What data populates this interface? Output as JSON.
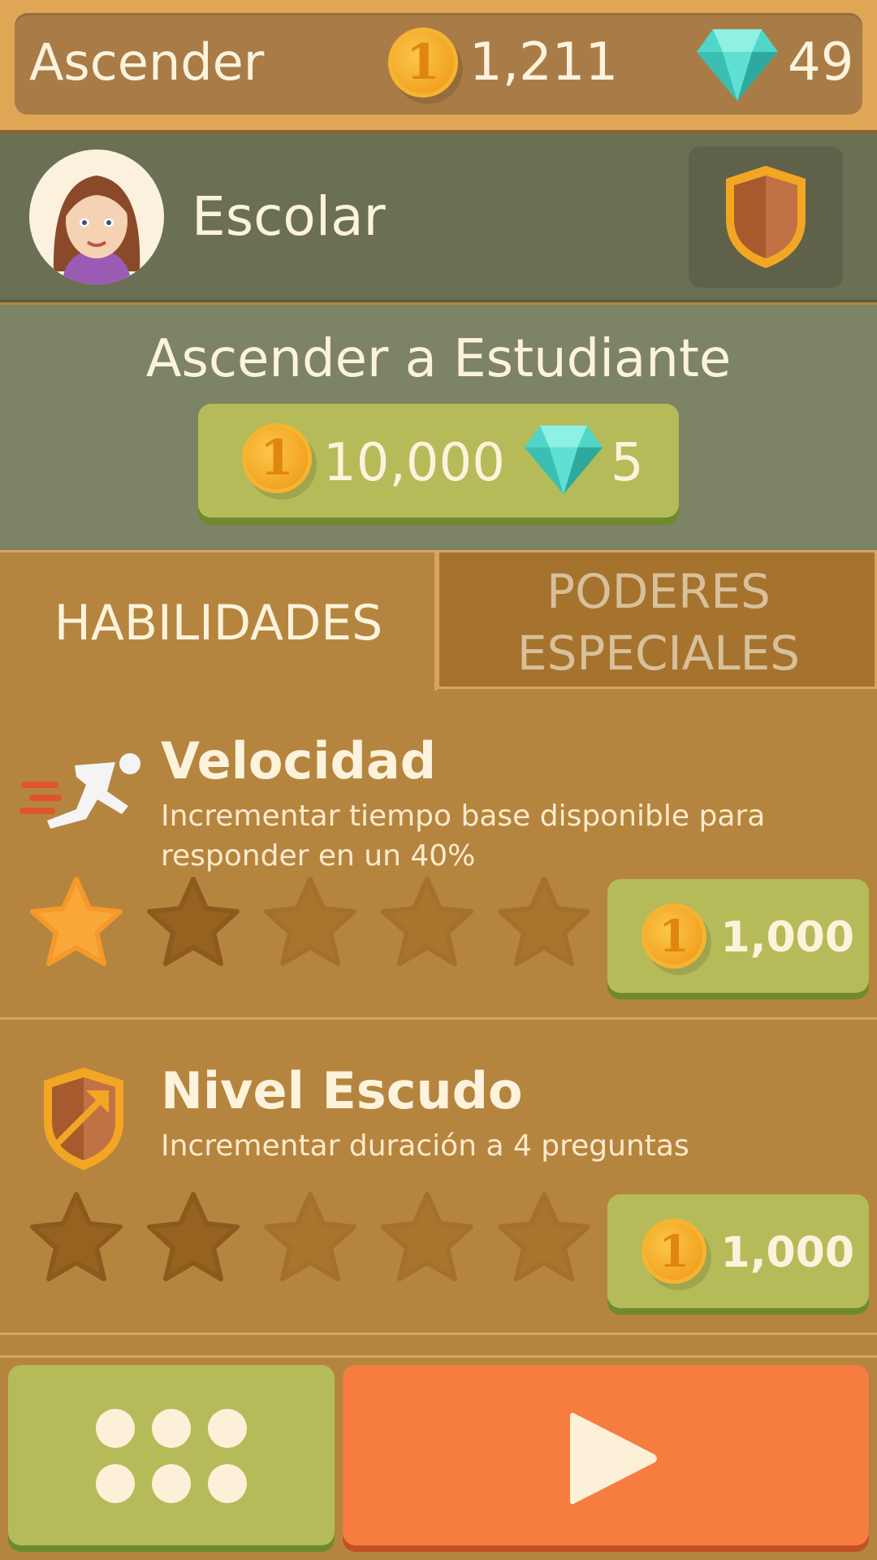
{
  "header": {
    "title": "Ascender",
    "coins": "1,211",
    "gems": "49",
    "coin_icon": "coin-icon",
    "gem_icon": "diamond-icon"
  },
  "profile": {
    "rank": "Escolar",
    "avatar_icon": "avatar-woman-icon",
    "badge_icon": "bronze-shield-icon"
  },
  "ascend": {
    "title": "Ascender a Estudiante",
    "coin_cost": "10,000",
    "gem_cost": "5"
  },
  "tabs": [
    {
      "label": "HABILIDADES",
      "active": true
    },
    {
      "label": "PODERES ESPECIALES",
      "active": false
    }
  ],
  "skills": [
    {
      "title": "Velocidad",
      "description": "Incrementar tiempo base disponible para responder en un 40%",
      "icon": "running-man-icon",
      "stars_filled": 1,
      "stars_total": 5,
      "cost": "1,000"
    },
    {
      "title": "Nivel Escudo",
      "description": "Incrementar duración a 4 preguntas",
      "icon": "shield-upgrade-icon",
      "stars_filled": 0,
      "stars_total": 5,
      "cost": "1,000"
    }
  ],
  "footer": {
    "menu_icon": "grid-menu-icon",
    "play_icon": "play-icon"
  },
  "colors": {
    "background": "#b5853f",
    "accent_green": "#b6bb59",
    "play_orange": "#f67c40",
    "text_cream": "#fdf3dc"
  }
}
